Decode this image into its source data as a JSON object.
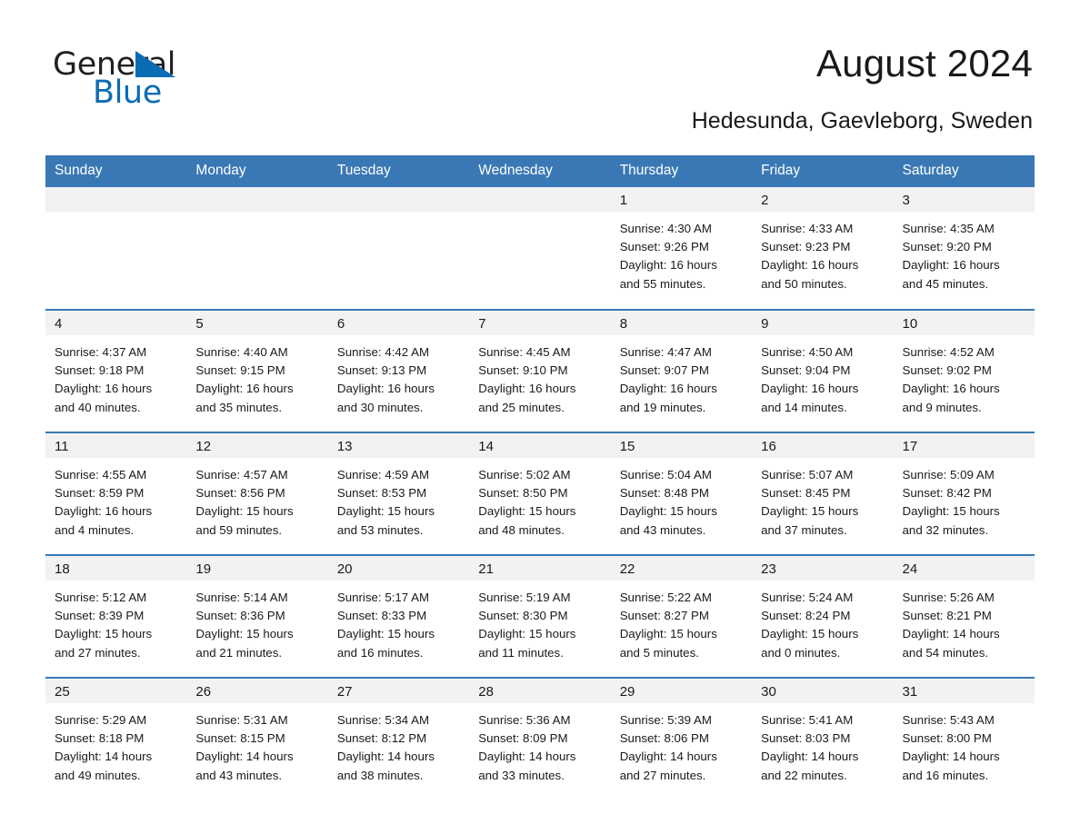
{
  "brand": {
    "name_part1": "General",
    "name_part2": "Blue",
    "accent_color": "#0b6cb3",
    "logo_icon": "triangle-flag-icon"
  },
  "header": {
    "month_title": "August 2024",
    "location": "Hedesunda, Gaevleborg, Sweden"
  },
  "calendar": {
    "header_bg": "#3a78b5",
    "daynum_bg": "#f2f2f2",
    "weekday_headers": [
      "Sunday",
      "Monday",
      "Tuesday",
      "Wednesday",
      "Thursday",
      "Friday",
      "Saturday"
    ],
    "weeks": [
      [
        {
          "day": "",
          "empty": true,
          "sunrise": "",
          "sunset": "",
          "daylight_line1": "",
          "daylight_line2": ""
        },
        {
          "day": "",
          "empty": true,
          "sunrise": "",
          "sunset": "",
          "daylight_line1": "",
          "daylight_line2": ""
        },
        {
          "day": "",
          "empty": true,
          "sunrise": "",
          "sunset": "",
          "daylight_line1": "",
          "daylight_line2": ""
        },
        {
          "day": "",
          "empty": true,
          "sunrise": "",
          "sunset": "",
          "daylight_line1": "",
          "daylight_line2": ""
        },
        {
          "day": "1",
          "empty": false,
          "sunrise": "Sunrise: 4:30 AM",
          "sunset": "Sunset: 9:26 PM",
          "daylight_line1": "Daylight: 16 hours",
          "daylight_line2": "and 55 minutes."
        },
        {
          "day": "2",
          "empty": false,
          "sunrise": "Sunrise: 4:33 AM",
          "sunset": "Sunset: 9:23 PM",
          "daylight_line1": "Daylight: 16 hours",
          "daylight_line2": "and 50 minutes."
        },
        {
          "day": "3",
          "empty": false,
          "sunrise": "Sunrise: 4:35 AM",
          "sunset": "Sunset: 9:20 PM",
          "daylight_line1": "Daylight: 16 hours",
          "daylight_line2": "and 45 minutes."
        }
      ],
      [
        {
          "day": "4",
          "empty": false,
          "sunrise": "Sunrise: 4:37 AM",
          "sunset": "Sunset: 9:18 PM",
          "daylight_line1": "Daylight: 16 hours",
          "daylight_line2": "and 40 minutes."
        },
        {
          "day": "5",
          "empty": false,
          "sunrise": "Sunrise: 4:40 AM",
          "sunset": "Sunset: 9:15 PM",
          "daylight_line1": "Daylight: 16 hours",
          "daylight_line2": "and 35 minutes."
        },
        {
          "day": "6",
          "empty": false,
          "sunrise": "Sunrise: 4:42 AM",
          "sunset": "Sunset: 9:13 PM",
          "daylight_line1": "Daylight: 16 hours",
          "daylight_line2": "and 30 minutes."
        },
        {
          "day": "7",
          "empty": false,
          "sunrise": "Sunrise: 4:45 AM",
          "sunset": "Sunset: 9:10 PM",
          "daylight_line1": "Daylight: 16 hours",
          "daylight_line2": "and 25 minutes."
        },
        {
          "day": "8",
          "empty": false,
          "sunrise": "Sunrise: 4:47 AM",
          "sunset": "Sunset: 9:07 PM",
          "daylight_line1": "Daylight: 16 hours",
          "daylight_line2": "and 19 minutes."
        },
        {
          "day": "9",
          "empty": false,
          "sunrise": "Sunrise: 4:50 AM",
          "sunset": "Sunset: 9:04 PM",
          "daylight_line1": "Daylight: 16 hours",
          "daylight_line2": "and 14 minutes."
        },
        {
          "day": "10",
          "empty": false,
          "sunrise": "Sunrise: 4:52 AM",
          "sunset": "Sunset: 9:02 PM",
          "daylight_line1": "Daylight: 16 hours",
          "daylight_line2": "and 9 minutes."
        }
      ],
      [
        {
          "day": "11",
          "empty": false,
          "sunrise": "Sunrise: 4:55 AM",
          "sunset": "Sunset: 8:59 PM",
          "daylight_line1": "Daylight: 16 hours",
          "daylight_line2": "and 4 minutes."
        },
        {
          "day": "12",
          "empty": false,
          "sunrise": "Sunrise: 4:57 AM",
          "sunset": "Sunset: 8:56 PM",
          "daylight_line1": "Daylight: 15 hours",
          "daylight_line2": "and 59 minutes."
        },
        {
          "day": "13",
          "empty": false,
          "sunrise": "Sunrise: 4:59 AM",
          "sunset": "Sunset: 8:53 PM",
          "daylight_line1": "Daylight: 15 hours",
          "daylight_line2": "and 53 minutes."
        },
        {
          "day": "14",
          "empty": false,
          "sunrise": "Sunrise: 5:02 AM",
          "sunset": "Sunset: 8:50 PM",
          "daylight_line1": "Daylight: 15 hours",
          "daylight_line2": "and 48 minutes."
        },
        {
          "day": "15",
          "empty": false,
          "sunrise": "Sunrise: 5:04 AM",
          "sunset": "Sunset: 8:48 PM",
          "daylight_line1": "Daylight: 15 hours",
          "daylight_line2": "and 43 minutes."
        },
        {
          "day": "16",
          "empty": false,
          "sunrise": "Sunrise: 5:07 AM",
          "sunset": "Sunset: 8:45 PM",
          "daylight_line1": "Daylight: 15 hours",
          "daylight_line2": "and 37 minutes."
        },
        {
          "day": "17",
          "empty": false,
          "sunrise": "Sunrise: 5:09 AM",
          "sunset": "Sunset: 8:42 PM",
          "daylight_line1": "Daylight: 15 hours",
          "daylight_line2": "and 32 minutes."
        }
      ],
      [
        {
          "day": "18",
          "empty": false,
          "sunrise": "Sunrise: 5:12 AM",
          "sunset": "Sunset: 8:39 PM",
          "daylight_line1": "Daylight: 15 hours",
          "daylight_line2": "and 27 minutes."
        },
        {
          "day": "19",
          "empty": false,
          "sunrise": "Sunrise: 5:14 AM",
          "sunset": "Sunset: 8:36 PM",
          "daylight_line1": "Daylight: 15 hours",
          "daylight_line2": "and 21 minutes."
        },
        {
          "day": "20",
          "empty": false,
          "sunrise": "Sunrise: 5:17 AM",
          "sunset": "Sunset: 8:33 PM",
          "daylight_line1": "Daylight: 15 hours",
          "daylight_line2": "and 16 minutes."
        },
        {
          "day": "21",
          "empty": false,
          "sunrise": "Sunrise: 5:19 AM",
          "sunset": "Sunset: 8:30 PM",
          "daylight_line1": "Daylight: 15 hours",
          "daylight_line2": "and 11 minutes."
        },
        {
          "day": "22",
          "empty": false,
          "sunrise": "Sunrise: 5:22 AM",
          "sunset": "Sunset: 8:27 PM",
          "daylight_line1": "Daylight: 15 hours",
          "daylight_line2": "and 5 minutes."
        },
        {
          "day": "23",
          "empty": false,
          "sunrise": "Sunrise: 5:24 AM",
          "sunset": "Sunset: 8:24 PM",
          "daylight_line1": "Daylight: 15 hours",
          "daylight_line2": "and 0 minutes."
        },
        {
          "day": "24",
          "empty": false,
          "sunrise": "Sunrise: 5:26 AM",
          "sunset": "Sunset: 8:21 PM",
          "daylight_line1": "Daylight: 14 hours",
          "daylight_line2": "and 54 minutes."
        }
      ],
      [
        {
          "day": "25",
          "empty": false,
          "sunrise": "Sunrise: 5:29 AM",
          "sunset": "Sunset: 8:18 PM",
          "daylight_line1": "Daylight: 14 hours",
          "daylight_line2": "and 49 minutes."
        },
        {
          "day": "26",
          "empty": false,
          "sunrise": "Sunrise: 5:31 AM",
          "sunset": "Sunset: 8:15 PM",
          "daylight_line1": "Daylight: 14 hours",
          "daylight_line2": "and 43 minutes."
        },
        {
          "day": "27",
          "empty": false,
          "sunrise": "Sunrise: 5:34 AM",
          "sunset": "Sunset: 8:12 PM",
          "daylight_line1": "Daylight: 14 hours",
          "daylight_line2": "and 38 minutes."
        },
        {
          "day": "28",
          "empty": false,
          "sunrise": "Sunrise: 5:36 AM",
          "sunset": "Sunset: 8:09 PM",
          "daylight_line1": "Daylight: 14 hours",
          "daylight_line2": "and 33 minutes."
        },
        {
          "day": "29",
          "empty": false,
          "sunrise": "Sunrise: 5:39 AM",
          "sunset": "Sunset: 8:06 PM",
          "daylight_line1": "Daylight: 14 hours",
          "daylight_line2": "and 27 minutes."
        },
        {
          "day": "30",
          "empty": false,
          "sunrise": "Sunrise: 5:41 AM",
          "sunset": "Sunset: 8:03 PM",
          "daylight_line1": "Daylight: 14 hours",
          "daylight_line2": "and 22 minutes."
        },
        {
          "day": "31",
          "empty": false,
          "sunrise": "Sunrise: 5:43 AM",
          "sunset": "Sunset: 8:00 PM",
          "daylight_line1": "Daylight: 14 hours",
          "daylight_line2": "and 16 minutes."
        }
      ]
    ]
  }
}
